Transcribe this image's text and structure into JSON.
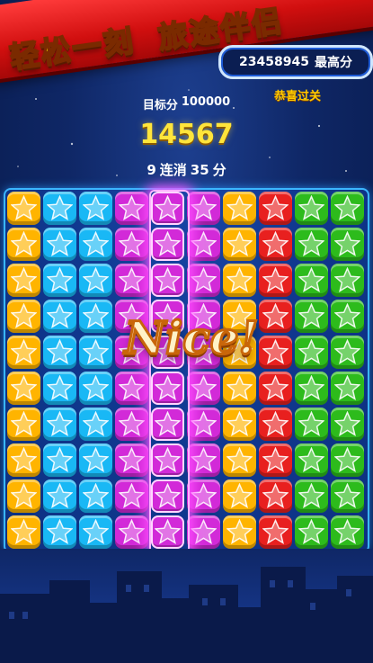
{
  "banner": {
    "left": "轻松一刻",
    "right": "旅途伴侣"
  },
  "high_score": {
    "value": "23458945",
    "label": "最高分"
  },
  "congrats": "恭喜过关",
  "target": {
    "label": "目标分",
    "value": "100000"
  },
  "score": "14567",
  "combo": {
    "count": "9",
    "combo_label": "连消",
    "points": "35",
    "points_label": "分"
  },
  "popup": "Nice!",
  "board": {
    "rows": 10,
    "cols": 10,
    "column_colors": [
      "yellow",
      "cyan",
      "cyan",
      "magenta",
      "magenta",
      "magenta",
      "yellow",
      "red",
      "green",
      "green"
    ],
    "highlighted_column": 4
  },
  "colors": {
    "yellow": "#ffb400",
    "cyan": "#19b8f5",
    "magenta": "#d22ad8",
    "red": "#e8201f",
    "green": "#2dbb1c",
    "banner_red": "#d10f0f",
    "score_gold": "#ffe53b"
  },
  "icons": {
    "tile": "star-icon"
  }
}
